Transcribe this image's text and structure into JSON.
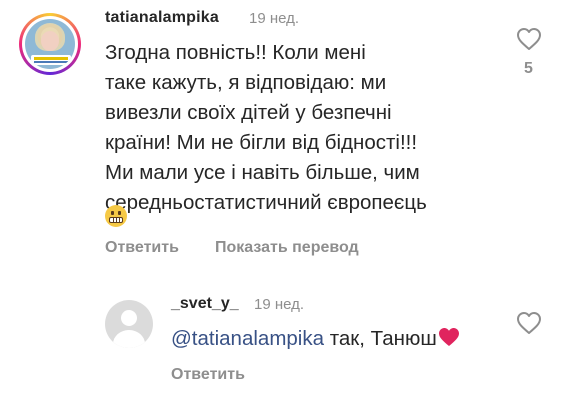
{
  "comment": {
    "username": "tatianalampika",
    "time": "19 нед.",
    "text_lines": [
      "Згодна повність!! Коли мені",
      "таке кажуть, я відповідаю: ми",
      "вивезли своїх дітей у безпечні",
      "країни! Ми не бігли від бідності!!!",
      "Ми мали усе і навіть більше, чим",
      "середньостатистичний європеєць"
    ],
    "emoji": "grimacing-face",
    "like_count": "5",
    "reply_label": "Ответить",
    "translate_label": "Показать перевод",
    "icon": "heart-outline-icon"
  },
  "reply": {
    "username": "_svet_y_",
    "time": "19 нед.",
    "mention": "@tatianalampika",
    "text": " так, Танюш",
    "emoji": "red-heart",
    "reply_label": "Ответить",
    "icon": "heart-outline-icon"
  },
  "colors": {
    "text": "#262626",
    "secondary": "#8e8e8e",
    "mention": "#385185",
    "heart_red": "#e0245e"
  }
}
